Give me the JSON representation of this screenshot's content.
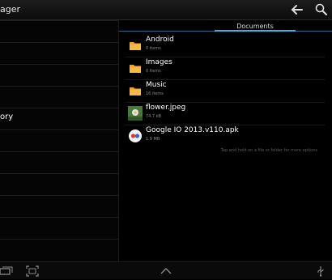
{
  "app_bar": {
    "title": "ager",
    "back_icon": "back-arrow-icon",
    "search_icon": "search-icon"
  },
  "left_pane": {
    "label": "ory"
  },
  "tabs": [
    {
      "label": "Documents",
      "selected": true
    }
  ],
  "files": [
    {
      "name": "Android",
      "meta": "0 items",
      "icon": "folder-icon"
    },
    {
      "name": "Images",
      "meta": "0 items",
      "icon": "folder-icon"
    },
    {
      "name": "Music",
      "meta": "16 items",
      "icon": "folder-icon"
    },
    {
      "name": "flower.jpeg",
      "meta": "74.7 kB",
      "icon": "image-thumbnail-icon"
    },
    {
      "name": "Google IO 2013.v110.apk",
      "meta": "1.9 MB",
      "icon": "io-app-icon"
    }
  ],
  "hint": "Tap and hold on a file or folder for more options",
  "colors": {
    "accent": "#33b5e5",
    "folder": "#f0a030",
    "background": "#000000"
  },
  "nav_icons": [
    "recent-apps-icon",
    "screenshot-icon",
    "home-up-icon",
    "usb-icon"
  ]
}
